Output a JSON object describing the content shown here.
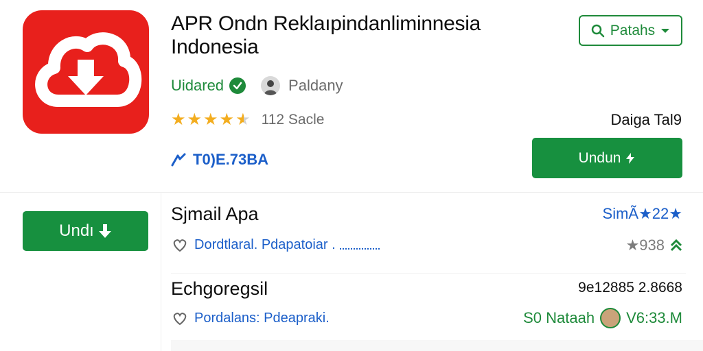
{
  "app": {
    "title": "APR Ondn Reklaıpindanliminnesia Indonesia",
    "developer": "Uidared",
    "publisher": "Paldany",
    "rating_value": 4.5,
    "rating_count": "112 Sacle",
    "data_label": "Daiga Tal9",
    "size_text": "T0)E.73BA",
    "download_label": "Undun",
    "filter_label": "Patahs"
  },
  "sidebar": {
    "download_label": "Undı"
  },
  "items": [
    {
      "title": "Sjmail Apa",
      "subtitle": "Dordtlaral. Pdapatoiar .",
      "right_text": "SimÃ★22★",
      "stat": "★938"
    },
    {
      "title": "Echgoregsil",
      "subtitle": "Pordalans: Pdeapraki.",
      "right_text": "9e12885 2.8668",
      "meta_label": "S0 Nataah",
      "meta_value": "V6:33.M"
    }
  ],
  "colors": {
    "brand_red": "#e8201c",
    "accent_green": "#17903f",
    "link_blue": "#1c5fc9",
    "star_gold": "#f3ad1f"
  },
  "icons": {
    "app_logo": "cloud-download-icon",
    "filter": "search-icon",
    "verified": "check-circle-icon",
    "size": "arrow-icon",
    "heart": "heart-icon",
    "trend": "chevrons-up-icon"
  }
}
